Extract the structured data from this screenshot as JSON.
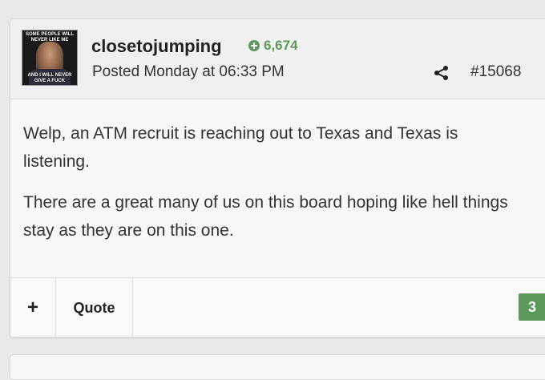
{
  "post": {
    "username": "closetojumping",
    "reputation": "6,674",
    "posted": "Posted Monday at 06:33 PM",
    "post_number": "#15068",
    "avatar": {
      "top_text": "SOME PEOPLE WILL NEVER LIKE ME",
      "bottom_text": "AND I WILL NEVER GIVE A FUCK"
    },
    "paragraphs": [
      "Welp, an ATM recruit is reaching out to Texas and Texas is listening.",
      "There are a great many of us on this board hoping like hell things stay as they are on this one."
    ]
  },
  "footer": {
    "plus_label": "+",
    "quote_label": "Quote",
    "reaction_count": "3"
  },
  "colors": {
    "accent_green": "#5b9a5a",
    "background": "#e9e9e9",
    "card": "#f7f7f7"
  },
  "icons": {
    "rep": "plus-circle-icon",
    "share": "share-icon"
  }
}
